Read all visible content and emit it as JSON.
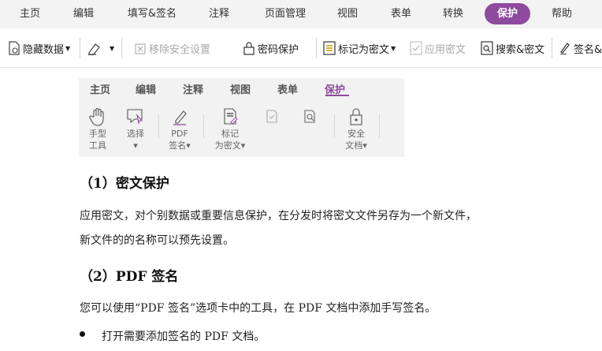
{
  "menubar": {
    "items": [
      "主页",
      "编辑",
      "填写&签名",
      "注释",
      "页面管理",
      "视图",
      "表单",
      "转换",
      "保护",
      "帮助"
    ],
    "active": "保护"
  },
  "toolbar": {
    "hide_data": "隐藏数据",
    "remove_security": "移除安全设置",
    "password_protect": "密码保护",
    "mark_redaction": "标记为密文",
    "apply_redaction": "应用密文",
    "search_redact": "搜索&密文",
    "sign": "签名&"
  },
  "ribbon": {
    "tabs": [
      "主页",
      "编辑",
      "注释",
      "视图",
      "表单",
      "保护"
    ],
    "active_tab": "保护",
    "tools": [
      {
        "line1": "手型",
        "line2": "工具"
      },
      {
        "line1": "选择",
        "line2": "▾"
      },
      {
        "line1": "PDF",
        "line2": "签名▾"
      },
      {
        "line1": "标记",
        "line2": "为密文▾"
      },
      {
        "line1": "安全",
        "line2": "文档▾"
      }
    ]
  },
  "doc": {
    "heading1": "（1）密文保护",
    "para1_line1": "应用密文，对个别数据或重要信息保护，在分发时将密文文件另存为一个新文件，",
    "para1_line2": "新文件的的名称可以预先设置。",
    "heading2": "（2）PDF 签名",
    "para2": "您可以使用“PDF 签名”选项卡中的工具，在 PDF 文档中添加手写签名。",
    "bullet1": "打开需要添加签名的 PDF 文档。"
  },
  "colors": {
    "accent": "#8e4a9e",
    "menubar_bg": "#f3f3f3",
    "disabled_text": "#a8a8a8"
  }
}
